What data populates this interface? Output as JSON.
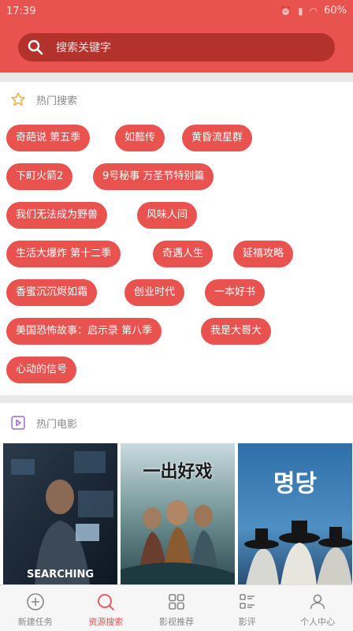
{
  "status_bar": {
    "time": "17:39",
    "battery": "60%"
  },
  "search": {
    "placeholder": "搜索关键字"
  },
  "hot_search": {
    "title": "热门搜索",
    "tags": [
      "奇葩说 第五季",
      "如懿传",
      "黄昏流星群",
      "下町火箭2",
      "9号秘事 万圣节特别篇",
      "我们无法成为野兽",
      "风味人间",
      "生活大爆炸 第十二季",
      "奇遇人生",
      "延禧攻略",
      "香蜜沉沉烬如霜",
      "创业时代",
      "一本好书",
      "美国恐怖故事：启示录 第八季",
      "我是大哥大",
      "心动的信号"
    ]
  },
  "hot_movies": {
    "title": "热门电影",
    "posters": [
      {
        "caption": "SEARCHING"
      },
      {
        "caption": "一出好戏"
      },
      {
        "caption": "명당"
      }
    ]
  },
  "tabs": [
    {
      "label": "新建任务",
      "icon": "plus-circle-icon"
    },
    {
      "label": "资源搜索",
      "icon": "search-icon",
      "active": true
    },
    {
      "label": "影视推荐",
      "icon": "grid-icon"
    },
    {
      "label": "影评",
      "icon": "list-icon"
    },
    {
      "label": "个人中心",
      "icon": "user-icon"
    }
  ],
  "colors": {
    "accent": "#e8524f",
    "search_bg": "#b4322c"
  }
}
